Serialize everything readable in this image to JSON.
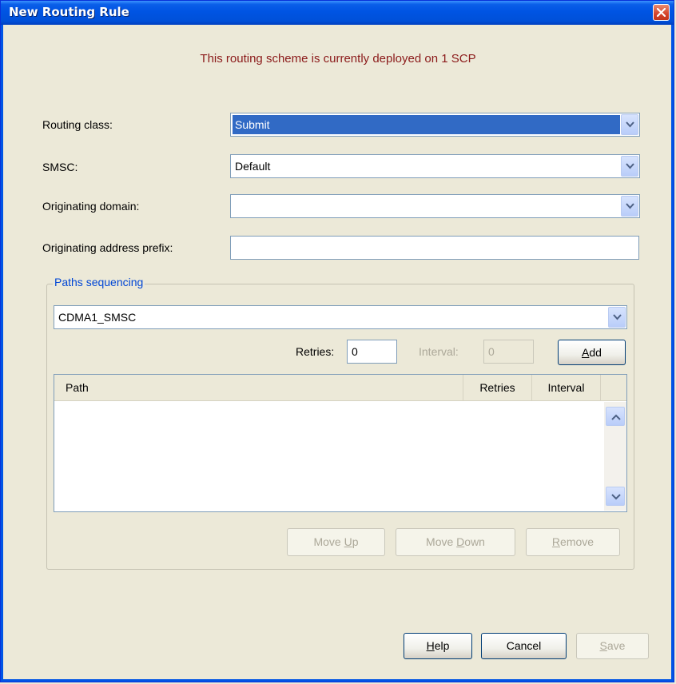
{
  "window": {
    "title": "New Routing Rule"
  },
  "notice": "This routing scheme is currently deployed on 1 SCP",
  "form": {
    "routing_class": {
      "label": "Routing class:",
      "value": "Submit"
    },
    "smsc": {
      "label": "SMSC:",
      "value": "Default"
    },
    "originating_domain": {
      "label": "Originating domain:",
      "value": ""
    },
    "originating_address_prefix": {
      "label": "Originating address prefix:",
      "value": ""
    }
  },
  "paths": {
    "legend": "Paths sequencing",
    "path_select": "CDMA1_SMSC",
    "retries_label": "Retries:",
    "retries_value": "0",
    "interval_label": "Interval:",
    "interval_value": "0",
    "add_button": {
      "label": "Add",
      "mnemonic": "A",
      "rest": "dd"
    },
    "table": {
      "columns": [
        "Path",
        "Retries",
        "Interval"
      ],
      "rows": []
    },
    "move_up": {
      "before": "Move ",
      "mnemonic": "U",
      "after": "p"
    },
    "move_down": {
      "before": "Move ",
      "mnemonic": "D",
      "after": "own"
    },
    "remove": {
      "before": "",
      "mnemonic": "R",
      "after": "emove"
    }
  },
  "footer": {
    "help": {
      "mnemonic": "H",
      "rest": "elp"
    },
    "cancel": "Cancel",
    "save": {
      "mnemonic": "S",
      "rest": "ave"
    }
  },
  "icons": {
    "close": "close-icon",
    "dropdown": "chevron-down-icon",
    "scroll_up": "arrow-up-icon",
    "scroll_down": "arrow-down-icon"
  },
  "colors": {
    "titlebar": "#0054e3",
    "notice_text": "#8b1a1a",
    "selection": "#316ac5",
    "legend_text": "#0046d5",
    "dialog_bg": "#ece9d8"
  }
}
